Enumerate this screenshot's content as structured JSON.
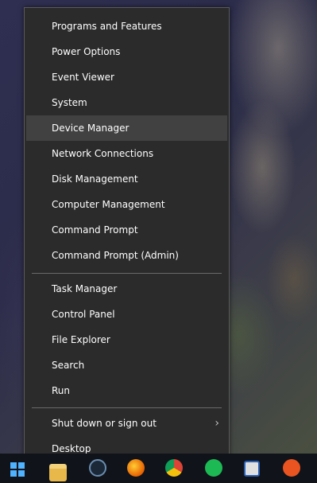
{
  "menu": {
    "items": [
      {
        "label": "Programs and Features"
      },
      {
        "label": "Power Options"
      },
      {
        "label": "Event Viewer"
      },
      {
        "label": "System"
      },
      {
        "label": "Device Manager"
      },
      {
        "label": "Network Connections"
      },
      {
        "label": "Disk Management"
      },
      {
        "label": "Computer Management"
      },
      {
        "label": "Command Prompt"
      },
      {
        "label": "Command Prompt (Admin)"
      },
      {
        "label": "Task Manager"
      },
      {
        "label": "Control Panel"
      },
      {
        "label": "File Explorer"
      },
      {
        "label": "Search"
      },
      {
        "label": "Run"
      },
      {
        "label": "Shut down or sign out"
      },
      {
        "label": "Desktop"
      }
    ],
    "hovered_item": "Device Manager",
    "submenu_glyph": "›"
  },
  "taskbar": {
    "icons": [
      "windows-start-icon",
      "file-explorer-icon",
      "steam-icon",
      "firefox-icon",
      "chrome-icon",
      "spotify-icon",
      "network-icon",
      "ubuntu-icon"
    ]
  },
  "colors": {
    "menu_bg": "#2b2b2b",
    "hover_bg": "#414141",
    "text": "#ffffff",
    "accent": "#4fb3ff"
  }
}
